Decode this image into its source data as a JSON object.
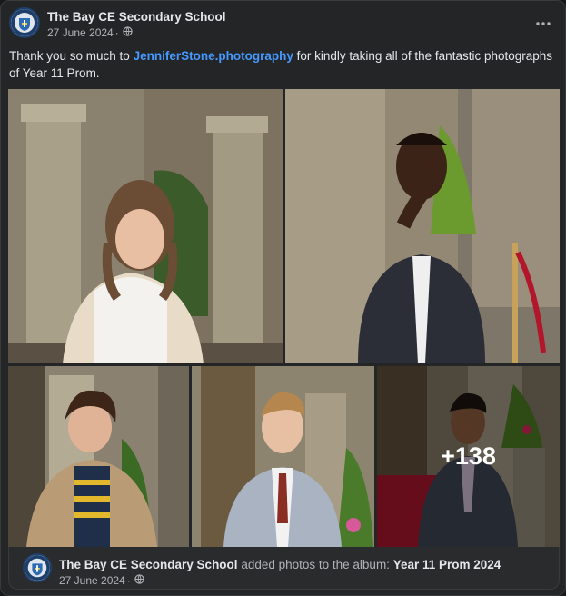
{
  "post": {
    "author": "The Bay CE Secondary School",
    "date": "27 June 2024",
    "audience_icon": "globe-icon",
    "more_icon": "more-options-icon",
    "caption_before": "Thank you so much to ",
    "caption_mention": "JenniferStone.photography",
    "caption_after": " for kindly taking all of the fantastic photographs of Year 11 Prom."
  },
  "gallery": {
    "photos": [
      {
        "subject": "girl in white dress by stone pillars"
      },
      {
        "subject": "boy in dark suit, hand on chin"
      },
      {
        "subject": "boy in beige coat and striped polo"
      },
      {
        "subject": "boy in grey suit with red tie"
      },
      {
        "subject": "boy in grey suit on red carpet"
      }
    ],
    "more_count": "+138"
  },
  "footer": {
    "author": "The Bay CE Secondary School",
    "action": " added photos to the album: ",
    "album": "Year 11 Prom 2024",
    "date": "27 June 2024"
  },
  "colors": {
    "card": "#242526",
    "text": "#e4e6eb",
    "secondary": "#b0b3b8",
    "link": "#4599ff"
  }
}
